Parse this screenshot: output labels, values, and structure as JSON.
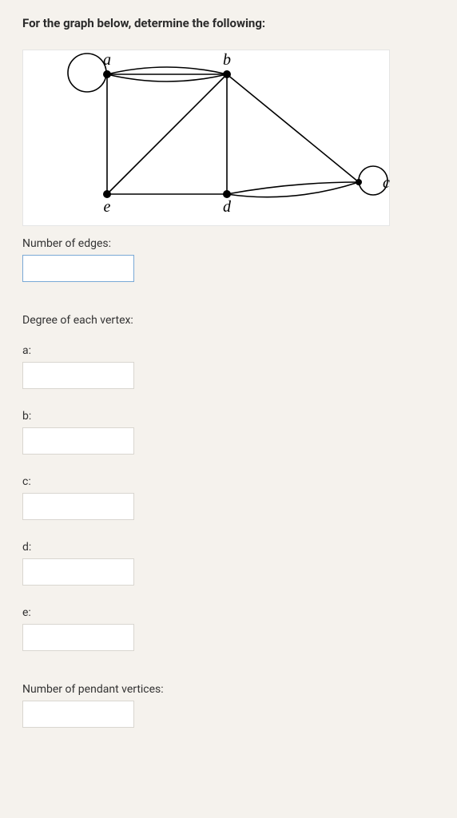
{
  "prompt": "For the graph below, determine the following:",
  "graph": {
    "labels": {
      "a": "a",
      "b": "b",
      "c": "c",
      "d": "d",
      "e": "e"
    }
  },
  "fields": {
    "numEdgesLabel": "Number of edges:",
    "degreeHeader": "Degree of each vertex:",
    "aLabel": "a:",
    "bLabel": "b:",
    "cLabel": "c:",
    "dLabel": "d:",
    "eLabel": "e:",
    "pendantLabel": "Number of pendant vertices:"
  }
}
